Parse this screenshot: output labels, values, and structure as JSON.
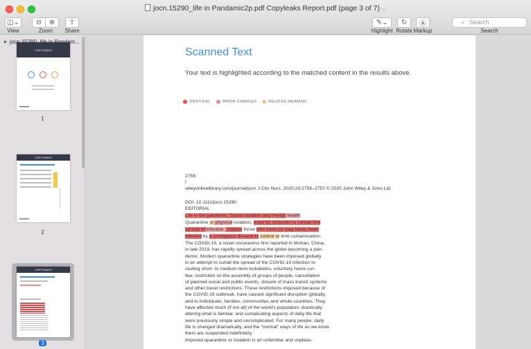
{
  "window": {
    "title": "jocn.15290_life in Pandamic2p.pdf Copyleaks Report.pdf (page 3 of 7)"
  },
  "toolbar": {
    "view_label": "View",
    "zoom_label": "Zoom",
    "share_label": "Share",
    "highlight_label": "Highlight",
    "rotate_label": "Rotate",
    "markup_label": "Markup",
    "search_label": "Search",
    "search_placeholder": "Search"
  },
  "sidebar": {
    "document_name": "jocn.15290_life in Pandam...",
    "thumbnails": [
      {
        "page": "1",
        "brand": "COPYLEAKS"
      },
      {
        "page": "2",
        "brand": "COPYLEAKS"
      },
      {
        "page": "3",
        "brand": "COPYLEAKS",
        "selected": true
      }
    ]
  },
  "document": {
    "heading": "Scanned Text",
    "intro": "Your text is highlighted according to the matched content in the results above.",
    "legend": [
      {
        "label": "IDENTICAL",
        "color": "#e84b4b"
      },
      {
        "label": "MINOR CHANGES",
        "color": "#f08a8a"
      },
      {
        "label": "RELATED MEANING",
        "color": "#f6c58a"
      }
    ],
    "page_number": "2756",
    "pipe": "|",
    "citation": "wileyonlinelibrary.com/journal/jocn J Clin Nurs. 2020;29:2756–2757.© 2020 John Wiley & Sons Ltd",
    "doi": "DOI: 10.1111/jocn.15290",
    "section": "EDITORIAL",
    "lines": [
      "The COVID-19, a novel coronavirus first reported in Wuhan, China,",
      "in late 2019, has rapidly spread across the globe becoming a pan-",
      "demic. Modern quarantine strategies have been imposed globally",
      "in an attempt to curtail the spread of the COVID-19 infection in-",
      "cluding short- to medium-term lockdowns, voluntary home cur-",
      "few, restriction on the assembly of groups of people, cancellation",
      "of planned social and public events, closure of mass transit systems",
      "and other travel restrictions. These restrictions imposed because of",
      "the COVID-19 outbreak, have caused significant disruption globally,",
      "and to individuals, families, communities and whole countries. They",
      "have affected much (if not all) of the world's population; drastically",
      "altering what is familiar, and complicating aspects of daily life that",
      "were previously simple and uncomplicated. For many people, daily",
      "life is changed dramatically, and the \"normal\" ways of life as we know",
      "them are suspended indefinitely.",
      "Imposed quarantine or isolation is an unfamiliar and unpleas-"
    ],
    "hl": {
      "l1a": "Life in the pandemic: Social isolation and mental",
      "l1b": " health",
      "l2a": "Quarantine ",
      "l2b": "or",
      "l2c": " physical",
      "l2d": " isolation, ",
      "l2e": "used for centuries to contain the",
      "l3a": "spread of ",
      "l3b": "infection, ",
      "l3c": "isolates",
      "l3d": " those ",
      "l3e": "who have (or may have) been",
      "l4a": "infected",
      "l4b": " by ",
      "l4c": "a contagious disease to",
      "l4d": " ",
      "l4e": "control",
      "l4f": " ",
      "l4g": "or",
      "l4h": " limit contamination."
    }
  }
}
